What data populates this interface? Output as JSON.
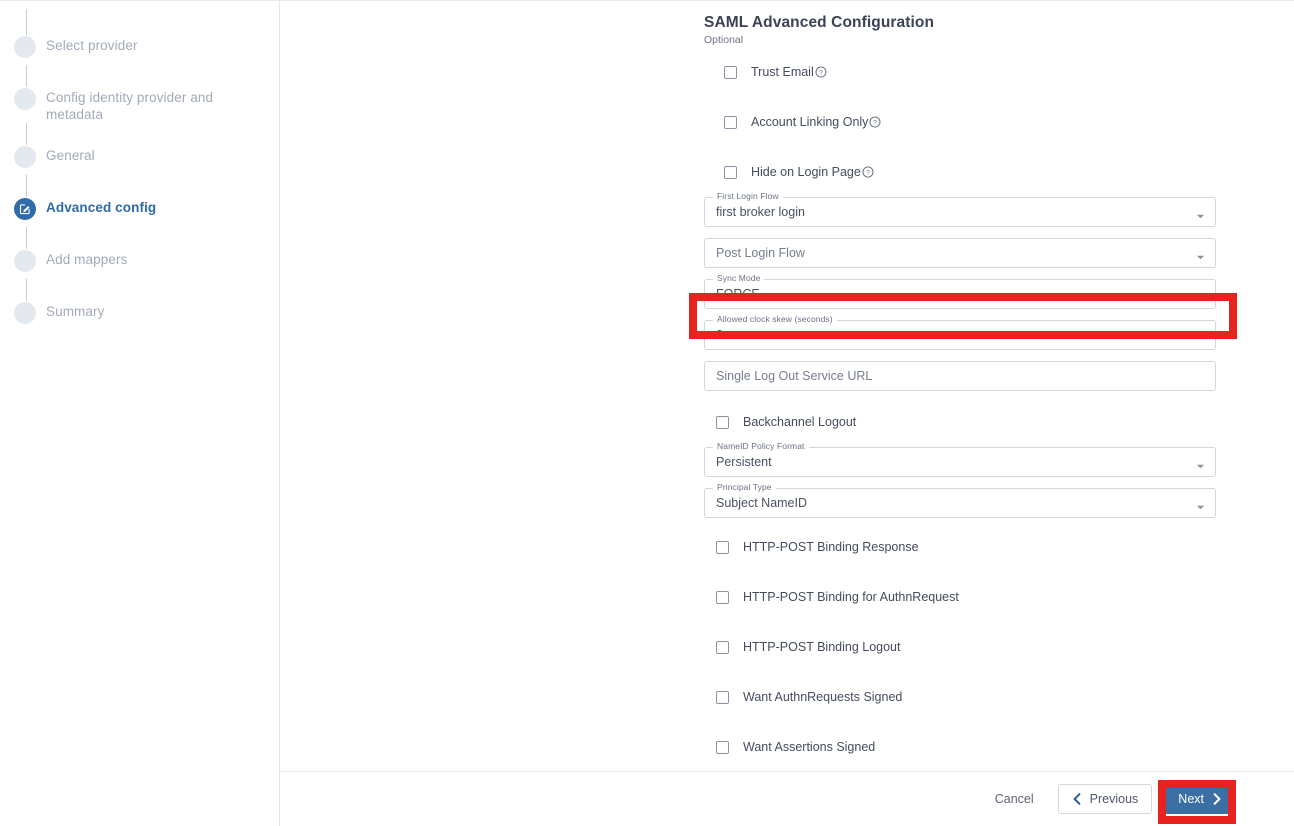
{
  "wizard": {
    "steps": [
      {
        "label": "Select provider",
        "state": "pending",
        "icon": "circle-icon"
      },
      {
        "label": "Config identity provider and metadata",
        "state": "pending",
        "icon": "circle-icon"
      },
      {
        "label": "General",
        "state": "pending",
        "icon": "circle-icon"
      },
      {
        "label": "Advanced config",
        "state": "active",
        "icon": "edit-pencil-icon"
      },
      {
        "label": "Add mappers",
        "state": "pending",
        "icon": "circle-icon"
      },
      {
        "label": "Summary",
        "state": "pending",
        "icon": "circle-icon"
      }
    ]
  },
  "form": {
    "title": "SAML Advanced Configuration",
    "subtitle": "Optional",
    "checkboxes_top": [
      {
        "label": "Trust Email",
        "checked": false,
        "help": true,
        "help_icon": "question-circle-icon"
      },
      {
        "label": "Account Linking Only",
        "checked": false,
        "help": true,
        "help_icon": "question-circle-icon"
      },
      {
        "label": "Hide on Login Page",
        "checked": false,
        "help": true,
        "help_icon": "question-circle-icon"
      }
    ],
    "first_login_flow": {
      "label": "First Login Flow",
      "value": "first broker login",
      "type": "select",
      "icon": "chevron-down-icon"
    },
    "post_login_flow": {
      "label": "",
      "placeholder": "Post Login Flow",
      "value": "",
      "type": "select",
      "icon": "chevron-down-icon"
    },
    "sync_mode": {
      "label": "Sync Mode",
      "value": "FORCE",
      "type": "select",
      "icon": "chevron-down-icon",
      "highlighted": true
    },
    "allowed_clock_skew": {
      "label": "Allowed clock skew (seconds)",
      "value": "3",
      "type": "text"
    },
    "single_logout_url": {
      "label": "",
      "placeholder": "Single Log Out Service URL",
      "value": "",
      "type": "text"
    },
    "backchannel_logout": {
      "label": "Backchannel Logout",
      "checked": false
    },
    "nameid_policy_format": {
      "label": "NameID Policy Format",
      "value": "Persistent",
      "type": "select",
      "icon": "chevron-down-icon"
    },
    "principal_type": {
      "label": "Principal Type",
      "value": "Subject NameID",
      "type": "select",
      "icon": "chevron-down-icon"
    },
    "checkboxes_bottom": [
      {
        "label": "HTTP-POST Binding Response",
        "checked": false
      },
      {
        "label": "HTTP-POST Binding for AuthnRequest",
        "checked": false
      },
      {
        "label": "HTTP-POST Binding Logout",
        "checked": false
      },
      {
        "label": "Want AuthnRequests Signed",
        "checked": false
      },
      {
        "label": "Want Assertions Signed",
        "checked": false
      }
    ]
  },
  "footer": {
    "cancel_label": "Cancel",
    "previous_label": "Previous",
    "previous_icon": "chevron-left-icon",
    "next_label": "Next",
    "next_icon": "chevron-right-icon",
    "next_highlighted": true
  },
  "colors": {
    "accent": "#2f6bab",
    "primary_button": "#3b6fa3",
    "annotation": "#e8221f",
    "muted_text": "#a3aab8"
  }
}
